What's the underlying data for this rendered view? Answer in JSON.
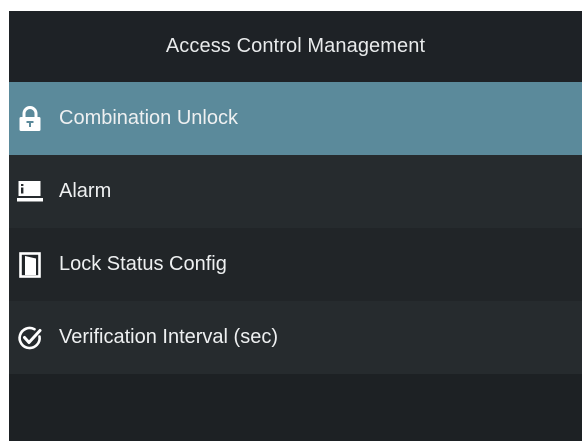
{
  "header": {
    "title": "Access Control Management"
  },
  "menu": {
    "items": [
      {
        "label": "Combination Unlock",
        "icon": "padlock-icon",
        "selected": true
      },
      {
        "label": "Alarm",
        "icon": "alarm-panel-icon",
        "selected": false
      },
      {
        "label": "Lock Status Config",
        "icon": "door-icon",
        "selected": false
      },
      {
        "label": "Verification Interval (sec)",
        "icon": "check-circle-icon",
        "selected": false
      }
    ]
  },
  "colors": {
    "background": "#1d2124",
    "selected_row": "#5b8a9b",
    "text": "#eef0f1"
  }
}
